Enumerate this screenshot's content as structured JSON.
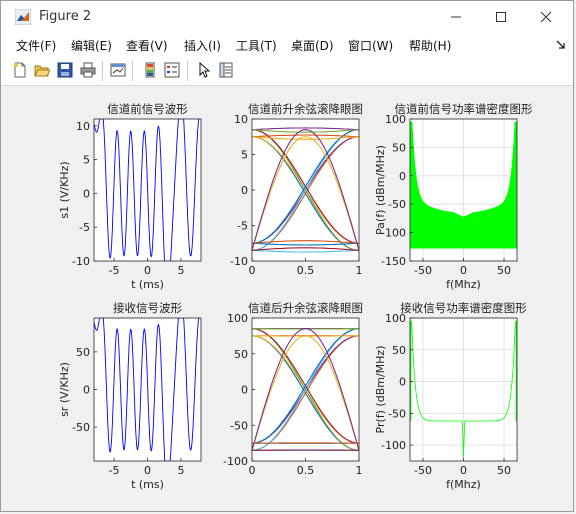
{
  "window": {
    "title": "Figure 2"
  },
  "menu": [
    "文件(F)",
    "编辑(E)",
    "查看(V)",
    "插入(I)",
    "工具(T)",
    "桌面(D)",
    "窗口(W)",
    "帮助(H)"
  ],
  "toolbar_icons": [
    "new-figure-icon",
    "open-file-icon",
    "save-icon",
    "print-icon",
    "link-plot-icon",
    "insert-colorbar-icon",
    "insert-legend-icon",
    "pointer-icon",
    "property-inspector-icon"
  ],
  "chart_data": [
    {
      "type": "line",
      "title": "信道前信号波形",
      "xlabel": "t (ms)",
      "ylabel": "s1  (V/KHz)",
      "xlim": [
        -8,
        8
      ],
      "ylim": [
        -10,
        11
      ],
      "xticks": [
        "-5",
        "0",
        "5"
      ],
      "yticks": [
        "10",
        "5",
        "0",
        "-5",
        "-10"
      ],
      "series": [
        {
          "color": "#0000ff",
          "bits": [
            1,
            1,
            -1,
            1,
            -1,
            1,
            -1,
            1,
            -1,
            1,
            -1,
            -1,
            1,
            1,
            -1,
            1
          ],
          "levels": [
            [
              1,
              9.2
            ],
            [
              -1,
              -9.2
            ]
          ]
        }
      ]
    },
    {
      "type": "line",
      "title": "信道前升余弦滚降眼图",
      "xlim": [
        0,
        1
      ],
      "ylim": [
        -10,
        10
      ],
      "xticks": [
        "0",
        "0.5",
        "1"
      ],
      "yticks": [
        "10",
        "5",
        "0",
        "-5",
        "-10"
      ],
      "series": [
        {
          "eye_levels": [
            -8.5,
            -7.5,
            7.5,
            8.5
          ]
        }
      ]
    },
    {
      "type": "line",
      "title": "信道前信号功率谱密度图形",
      "xlabel": "f(Mhz)",
      "ylabel": "Pa(f) (dBm/MHz)",
      "xlim": [
        -66,
        66
      ],
      "ylim": [
        -150,
        100
      ],
      "xticks": [
        "-50",
        "0",
        "50"
      ],
      "yticks": [
        "100",
        "50",
        "0",
        "-50",
        "-100",
        "-150"
      ],
      "grid": true,
      "series": [
        {
          "color": "#00ff00",
          "floor": -128,
          "envelope_min": -65,
          "edge": 95
        }
      ]
    },
    {
      "type": "line",
      "title": "接收信号波形",
      "xlabel": "t (ms)",
      "ylabel": "sr  (V/KHz)",
      "xlim": [
        -8,
        8
      ],
      "ylim": [
        -95,
        95
      ],
      "xticks": [
        "-5",
        "0",
        "5"
      ],
      "yticks": [
        "50",
        "0",
        "-50"
      ],
      "series": [
        {
          "color": "#0000ff",
          "bits": [
            1,
            1,
            -1,
            1,
            -1,
            1,
            -1,
            1,
            -1,
            1,
            -1,
            -1,
            1,
            1,
            -1,
            1
          ],
          "levels": [
            [
              1,
              80
            ],
            [
              -1,
              -80
            ]
          ]
        }
      ]
    },
    {
      "type": "line",
      "title": "信道后升余弦滚降眼图",
      "xlim": [
        0,
        1
      ],
      "ylim": [
        -100,
        100
      ],
      "xticks": [
        "0",
        "0.5",
        "1"
      ],
      "yticks": [
        "100",
        "50",
        "0",
        "-50",
        "-100"
      ],
      "series": [
        {
          "eye_levels": [
            -85,
            -75,
            75,
            85
          ]
        }
      ]
    },
    {
      "type": "line",
      "title": "接收信号功率谱密度图形",
      "xlabel": "f(Mhz)",
      "ylabel": "Pr(f) (dBm/MHz)",
      "xlim": [
        -66,
        66
      ],
      "ylim": [
        -125,
        100
      ],
      "xticks": [
        "-50",
        "0",
        "50"
      ],
      "yticks": [
        "100",
        "50",
        "0",
        "-50",
        "-100"
      ],
      "grid": true,
      "series": [
        {
          "color": "#00ff00",
          "floor": -62,
          "center_dip": -120,
          "edge": 95
        }
      ]
    }
  ]
}
